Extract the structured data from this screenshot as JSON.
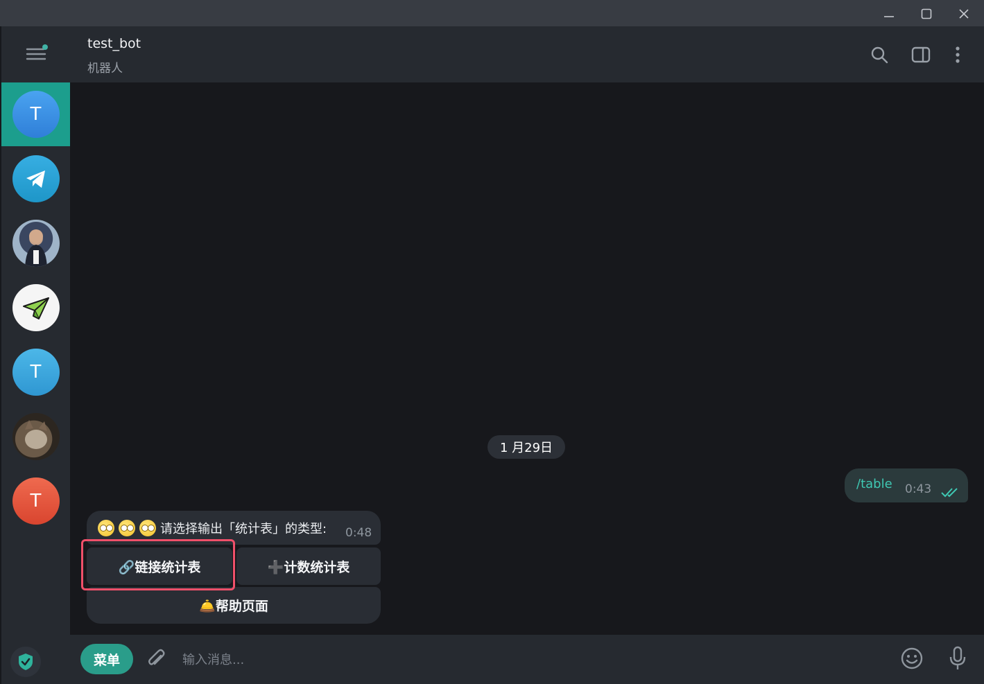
{
  "window": {
    "minimize_icon": "minimize-icon",
    "maximize_icon": "maximize-icon",
    "close_icon": "close-icon"
  },
  "sidebar": {
    "chats": [
      {
        "initial": "T",
        "color": "#3d8fe6",
        "active": true
      },
      {
        "initial": "",
        "icon": "telegram-logo",
        "color": "#2aa3de"
      },
      {
        "initial": "",
        "icon": "person-photo",
        "color": "#8aa0b5"
      },
      {
        "initial": "",
        "icon": "paper-plane-logo",
        "color": "#f5f5f5"
      },
      {
        "initial": "T",
        "color": "#3ea8dc"
      },
      {
        "initial": "",
        "icon": "cat-photo",
        "color": "#6b5a48"
      },
      {
        "initial": "T",
        "color": "#e3573f"
      }
    ]
  },
  "header": {
    "title": "test_bot",
    "subtitle": "机器人"
  },
  "chat": {
    "date": "1 月29日",
    "outgoing": {
      "text": "/table",
      "time": "0:43"
    },
    "incoming": {
      "text": "请选择输出「统计表」的类型:",
      "time": "0:48"
    },
    "keyboard": {
      "link_stats": "🔗链接统计表",
      "count_stats": "➕计数统计表",
      "help": "🛎️帮助页面"
    }
  },
  "input": {
    "menu_label": "菜单",
    "placeholder": "输入消息..."
  },
  "colors": {
    "accent": "#2a9d8a",
    "highlight": "#f0506a"
  }
}
